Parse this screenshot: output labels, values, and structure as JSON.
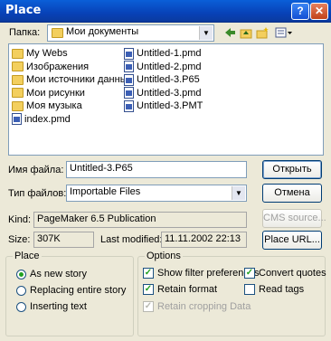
{
  "window": {
    "title": "Place",
    "help_label": "?",
    "close_label": "✕"
  },
  "lookin": {
    "label": "Папка:",
    "value": "Мои документы"
  },
  "files": {
    "col1": [
      {
        "name": "My Webs",
        "type": "folder"
      },
      {
        "name": "Изображения",
        "type": "folder"
      },
      {
        "name": "Мои источники данных",
        "type": "folder"
      },
      {
        "name": "Мои рисунки",
        "type": "folder"
      },
      {
        "name": "Моя музыка",
        "type": "folder"
      },
      {
        "name": "index.pmd",
        "type": "doc"
      }
    ],
    "col2": [
      {
        "name": "Untitled-1.pmd",
        "type": "doc"
      },
      {
        "name": "Untitled-2.pmd",
        "type": "doc"
      },
      {
        "name": "Untitled-3.P65",
        "type": "doc"
      },
      {
        "name": "Untitled-3.pmd",
        "type": "doc"
      },
      {
        "name": "Untitled-3.PMT",
        "type": "doc"
      }
    ]
  },
  "filename": {
    "label": "Имя файла:",
    "value": "Untitled-3.P65"
  },
  "filetype": {
    "label": "Тип файлов:",
    "value": "Importable Files"
  },
  "buttons": {
    "open": "Открыть",
    "cancel": "Отмена",
    "cms": "CMS source...",
    "url": "Place URL..."
  },
  "info": {
    "kind_label": "Kind:",
    "kind_value": "PageMaker 6.5 Publication",
    "size_label": "Size:",
    "size_value": "307K",
    "modified_label": "Last modified:",
    "modified_value": "11.11.2002 22:13"
  },
  "place_group": {
    "title": "Place",
    "options": [
      {
        "label": "As new story",
        "selected": true
      },
      {
        "label": "Replacing entire story",
        "selected": false
      },
      {
        "label": "Inserting text",
        "selected": false
      }
    ]
  },
  "options_group": {
    "title": "Options",
    "show_filter": {
      "label": "Show filter preferences",
      "checked": true
    },
    "convert_quotes": {
      "label": "Convert quotes",
      "checked": true
    },
    "retain_format": {
      "label": "Retain format",
      "checked": true
    },
    "read_tags": {
      "label": "Read tags",
      "checked": false
    },
    "retain_cropping": {
      "label": "Retain cropping Data",
      "checked": true,
      "disabled": true
    }
  }
}
